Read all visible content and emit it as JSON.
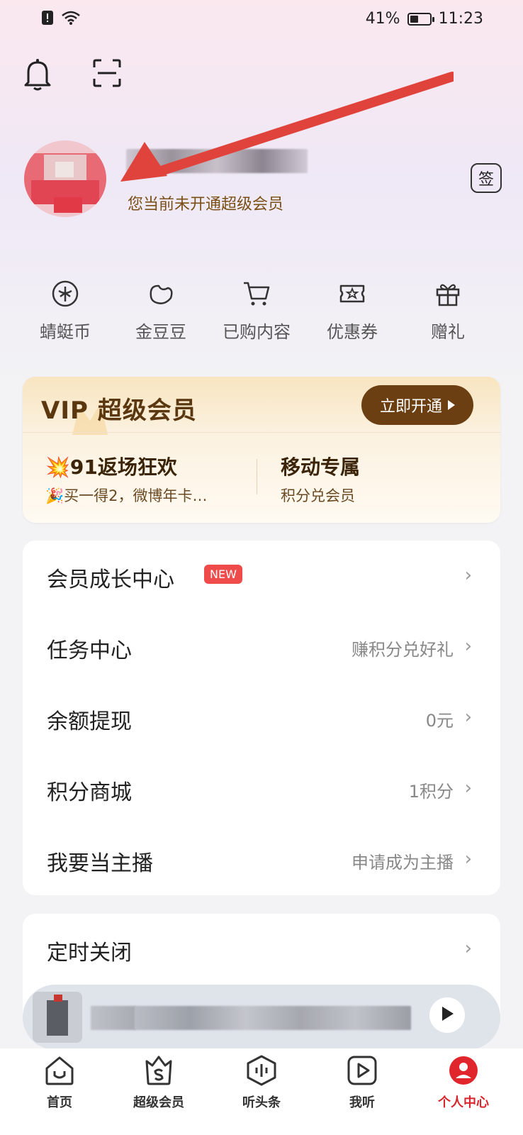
{
  "status_bar": {
    "battery": "41%",
    "battery_level": 0.41,
    "time": "11:23"
  },
  "profile": {
    "subtitle": "您当前未开通超级会员",
    "sign_label": "签"
  },
  "quick_actions": [
    {
      "label": "蜻蜓币",
      "icon": "dragonfly-coin-icon"
    },
    {
      "label": "金豆豆",
      "icon": "bean-icon"
    },
    {
      "label": "已购内容",
      "icon": "cart-icon"
    },
    {
      "label": "优惠券",
      "icon": "coupon-icon"
    },
    {
      "label": "赠礼",
      "icon": "gift-icon"
    }
  ],
  "vip_card": {
    "title": "VIP 超级会员",
    "button": "立即开通",
    "promos": [
      {
        "title": "💥91返场狂欢",
        "subtitle": "🎉买一得2，微博年卡…"
      },
      {
        "title": "移动专属",
        "subtitle": "积分兑会员"
      }
    ]
  },
  "menu1": [
    {
      "label": "会员成长中心",
      "badge": "NEW",
      "value": ""
    },
    {
      "label": "任务中心",
      "value": "赚积分兑好礼"
    },
    {
      "label": "余额提现",
      "value": "0元"
    },
    {
      "label": "积分商城",
      "value": "1积分"
    },
    {
      "label": "我要当主播",
      "value": "申请成为主播"
    }
  ],
  "menu2": [
    {
      "label": "定时关闭",
      "value": ""
    }
  ],
  "tabbar": [
    {
      "label": "首页",
      "icon": "home-icon"
    },
    {
      "label": "超级会员",
      "icon": "vip-bag-icon"
    },
    {
      "label": "听头条",
      "icon": "audio-wave-icon"
    },
    {
      "label": "我听",
      "icon": "play-square-icon"
    },
    {
      "label": "个人中心",
      "icon": "profile-icon"
    }
  ],
  "colors": {
    "accent": "#d8262c",
    "vip_button": "#6b3f12",
    "vip_text": "#5b3710",
    "badge": "#f04b4b"
  }
}
